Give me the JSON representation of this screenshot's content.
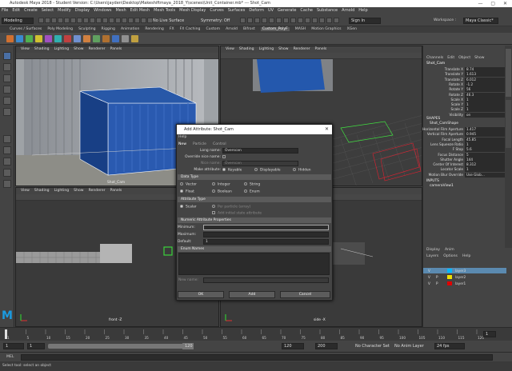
{
  "window": {
    "title": "Autodesk Maya 2018 - Student Version: C:\\Users\\jayden\\Desktop\\Makeshiftmaya_2018_Y\\scenes\\Unit_Container.mb*  ---  Shot_Cam"
  },
  "menu": [
    "File",
    "Edit",
    "Create",
    "Select",
    "Modify",
    "Display",
    "Windows",
    "Mesh",
    "Edit Mesh",
    "Mesh Tools",
    "Mesh Display",
    "Curves",
    "Surfaces",
    "Deform",
    "UV",
    "Generate",
    "Cache",
    "Substance",
    "Arnold",
    "Help"
  ],
  "statusline": {
    "mode": "Modeling",
    "no_live": "No Live Surface",
    "symmetry": "Symmetry: Off",
    "signin": "Sign In",
    "workspace_label": "Workspace :",
    "workspace": "Maya Classic*"
  },
  "shelf_tabs": [
    "Curves / Surfaces",
    "Poly Modeling",
    "Sculpting",
    "Rigging",
    "Animation",
    "Rendering",
    "FX",
    "FX Caching",
    "Custom",
    "Arnold",
    "Bifrost",
    "Custom_PolyF",
    "MASH",
    "Motion Graphics",
    "XGen"
  ],
  "shelf_active": "Custom_PolyF",
  "viewport_menu": [
    "View",
    "Shading",
    "Lighting",
    "Show",
    "Renderer",
    "Panels"
  ],
  "viewports": {
    "persp_label": "Shot_Cam",
    "front_label": "front -Z",
    "side_label": "side -X"
  },
  "channel_box": {
    "tabs": [
      "Channels",
      "Edit",
      "Object",
      "Show"
    ],
    "object": "Shot_Cam",
    "attrs": [
      [
        "Translate X",
        "8.74"
      ],
      [
        "Translate Y",
        "1.613"
      ],
      [
        "Translate Z",
        "6.012"
      ],
      [
        "Rotate X",
        "-1.2"
      ],
      [
        "Rotate Y",
        "56"
      ],
      [
        "Rotate Z",
        "46.3"
      ],
      [
        "Scale X",
        "1"
      ],
      [
        "Scale Y",
        "1"
      ],
      [
        "Scale Z",
        "1"
      ],
      [
        "Visibility",
        "on"
      ]
    ],
    "shapes_label": "SHAPES",
    "shape_name": "Shot_CamShape",
    "shape_attrs": [
      [
        "Horizontal Film Aperture",
        "1.417"
      ],
      [
        "Vertical Film Aperture",
        "0.945"
      ],
      [
        "Focal Length",
        "45.85"
      ],
      [
        "Lens Squeeze Ratio",
        "1"
      ],
      [
        "F Stop",
        "5.6"
      ],
      [
        "Focus Distance",
        "5"
      ],
      [
        "Shutter Angle",
        "144"
      ],
      [
        "Center Of Interest",
        "8.312"
      ],
      [
        "Locator Scale",
        "1"
      ],
      [
        "Motion Blur Override",
        "Use Glob..."
      ]
    ],
    "inputs_label": "INPUTS",
    "input_name": "cameraView1"
  },
  "layer_editor": {
    "tabs": [
      "Display",
      "Anim"
    ],
    "menus": [
      "Layers",
      "Options",
      "Help"
    ],
    "layers": [
      {
        "name": "layer3",
        "color": "#00b8ff",
        "v": "V",
        "p": ""
      },
      {
        "name": "layer2",
        "color": "#f0e000",
        "v": "V",
        "p": "P"
      },
      {
        "name": "layer1",
        "color": "#e00000",
        "v": "V",
        "p": "P"
      }
    ]
  },
  "dialog": {
    "title": "Add Attribute: Shot_Cam",
    "menu": "Help",
    "tabs": [
      "New",
      "Particle",
      "Control"
    ],
    "long_name_label": "Long name:",
    "long_name_value": "Overscan",
    "override_label": "Override nice name:",
    "nice_name_label": "Nice name:",
    "nice_name_value": "Overscan",
    "make_attr_label": "Make attribute:",
    "make_opts": [
      "Keyable",
      "Displayable",
      "Hidden"
    ],
    "data_type_header": "Data Type",
    "data_types": [
      "Vector",
      "Integer",
      "String",
      "Float",
      "Boolean",
      "Enum"
    ],
    "data_type_selected": "Float",
    "attr_type_header": "Attribute Type",
    "attr_types": [
      "Scalar",
      "Per particle (array)",
      "Add initial state attribute"
    ],
    "numeric_header": "Numeric Attribute Properties",
    "min_label": "Minimum:",
    "max_label": "Maximum:",
    "default_label": "Default:",
    "default_value": "1",
    "enum_header": "Enum Names",
    "new_name_label": "New name:",
    "buttons": [
      "OK",
      "Add",
      "Cancel"
    ]
  },
  "time": {
    "ticks": [
      "1",
      "5",
      "10",
      "15",
      "20",
      "25",
      "30",
      "35",
      "40",
      "45",
      "50",
      "55",
      "60",
      "65",
      "70",
      "75",
      "80",
      "85",
      "90",
      "95",
      "100",
      "105",
      "110",
      "115",
      "120"
    ],
    "start": "1",
    "current": "1",
    "range_start": "1",
    "range_end": "120",
    "end": "120",
    "end2": "200",
    "char_set": "No Character Set",
    "anim_layer": "No Anim Layer",
    "fps": "24 fps"
  },
  "command": {
    "label": "MEL"
  },
  "help": {
    "text": "Select tool: select an object"
  }
}
